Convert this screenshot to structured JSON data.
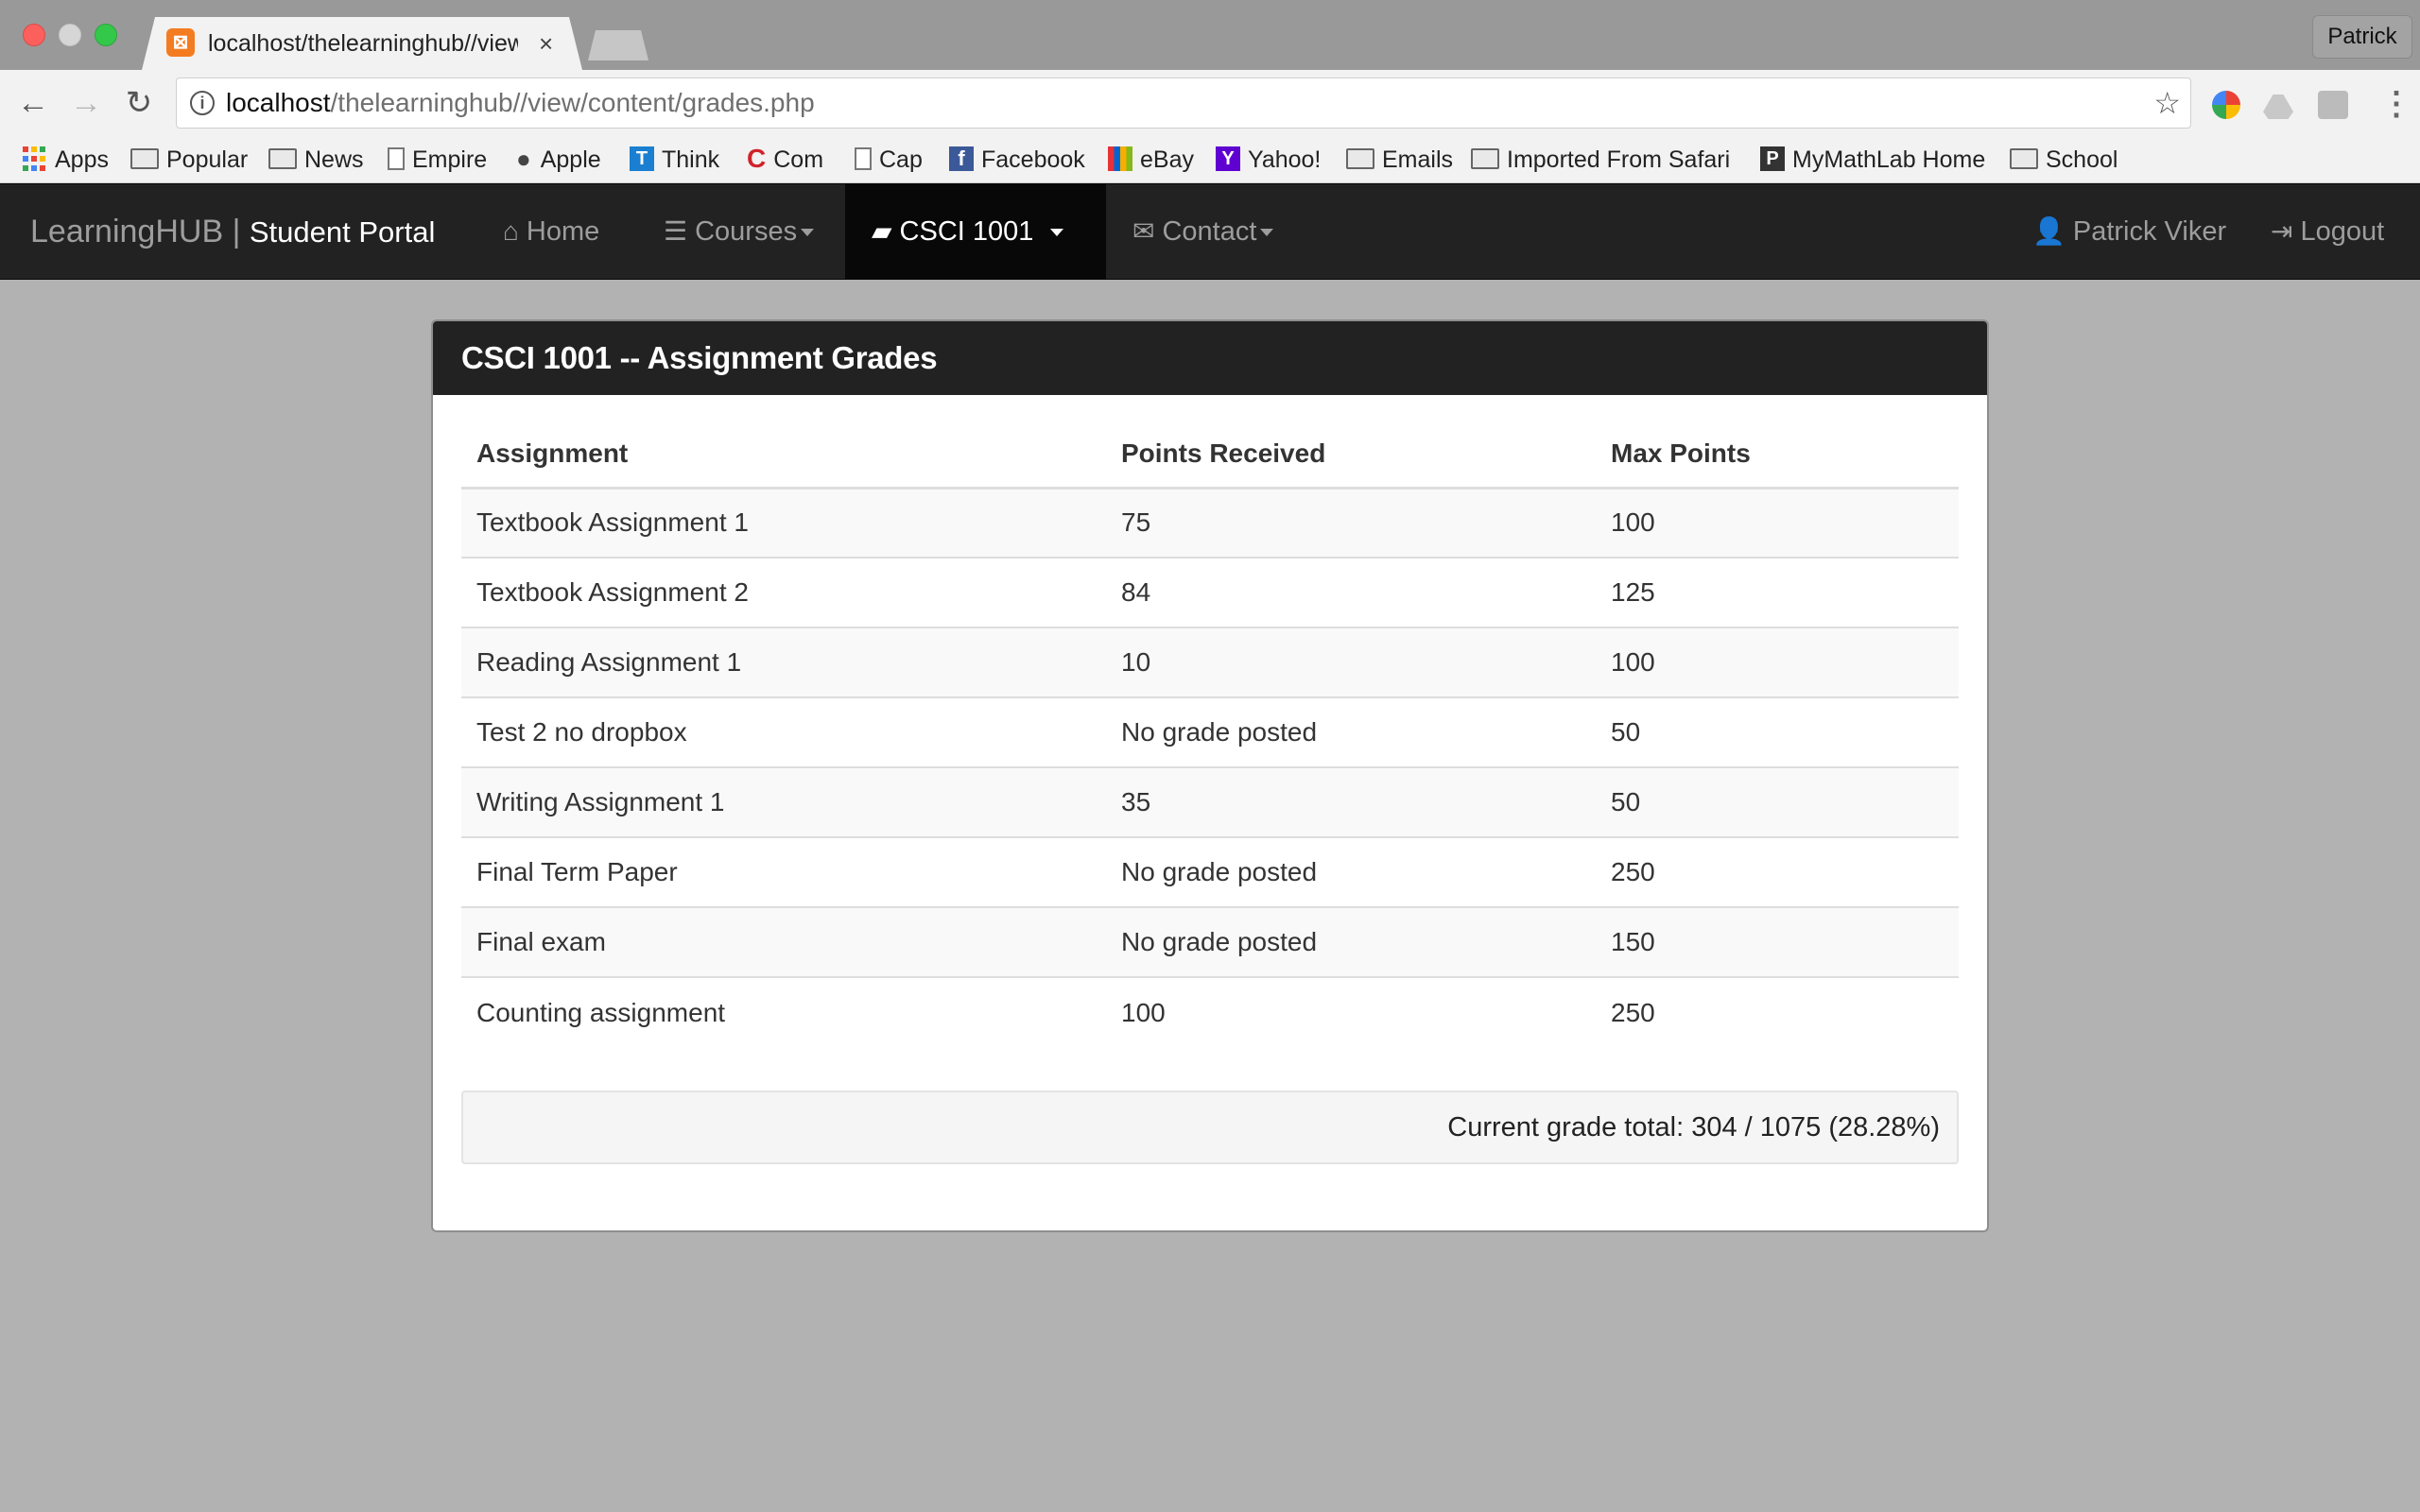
{
  "browser": {
    "tab_title": "localhost/thelearninghub//view/content/grades.php",
    "profile_name": "Patrick",
    "url_host": "localhost",
    "url_path": "/thelearninghub//view/content/grades.php",
    "bookmarks": [
      {
        "label": "Apps",
        "icon": "apps-grid-icon"
      },
      {
        "label": "Popular",
        "icon": "folder-icon"
      },
      {
        "label": "News",
        "icon": "folder-icon"
      },
      {
        "label": "Empire",
        "icon": "page-icon"
      },
      {
        "label": "Apple",
        "icon": "apple-icon"
      },
      {
        "label": "Think",
        "icon": "think-icon"
      },
      {
        "label": "Com",
        "icon": "com-icon"
      },
      {
        "label": "Cap",
        "icon": "page-icon"
      },
      {
        "label": "Facebook",
        "icon": "facebook-icon"
      },
      {
        "label": "eBay",
        "icon": "ebay-icon"
      },
      {
        "label": "Yahoo!",
        "icon": "yahoo-icon"
      },
      {
        "label": "Emails",
        "icon": "folder-icon"
      },
      {
        "label": "Imported From Safari",
        "icon": "folder-icon"
      },
      {
        "label": "MyMathLab Home",
        "icon": "p-icon"
      },
      {
        "label": "School",
        "icon": "folder-icon"
      }
    ]
  },
  "navbar": {
    "brand": "LearningHUB",
    "brand_separator": "|",
    "brand_sub": "Student Portal",
    "items": [
      {
        "label": "Home",
        "icon": "home-icon"
      },
      {
        "label": "Courses",
        "icon": "list-icon"
      },
      {
        "label": "CSCI 1001",
        "icon": "folder-open-icon"
      },
      {
        "label": "Contact",
        "icon": "envelope-icon"
      }
    ],
    "user": {
      "label": "Patrick Viker",
      "icon": "user-icon"
    },
    "logout": {
      "label": "Logout",
      "icon": "log-in-icon"
    }
  },
  "panel": {
    "title": "CSCI 1001 -- Assignment Grades",
    "columns": [
      "Assignment",
      "Points Received",
      "Max Points"
    ],
    "rows": [
      [
        "Textbook Assignment 1",
        "75",
        "100"
      ],
      [
        "Textbook Assignment 2",
        "84",
        "125"
      ],
      [
        "Reading Assignment 1",
        "10",
        "100"
      ],
      [
        "Test 2 no dropbox",
        "No grade posted",
        "50"
      ],
      [
        "Writing Assignment 1",
        "35",
        "50"
      ],
      [
        "Final Term Paper",
        "No grade posted",
        "250"
      ],
      [
        "Final exam",
        "No grade posted",
        "150"
      ],
      [
        "Counting assignment",
        "100",
        "250"
      ]
    ],
    "total": "Current grade total: 304 / 1075 (28.28%)"
  },
  "colors": {
    "navbar_bg": "#222222",
    "navbar_active": "#080808",
    "page_bg": "#b2b2b2",
    "tab_favicon": "#f47c20"
  }
}
